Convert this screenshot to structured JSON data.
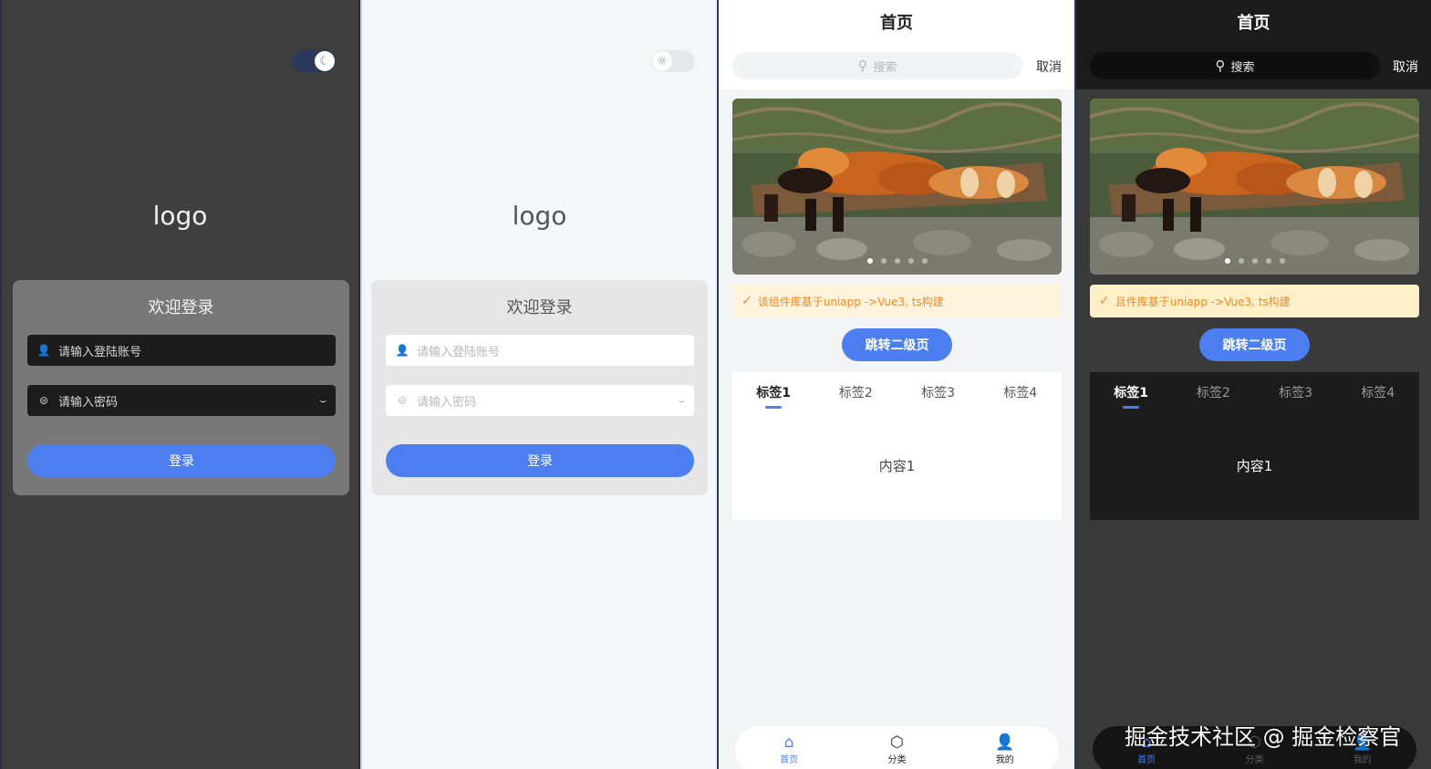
{
  "login": {
    "logo": "logo",
    "title": "欢迎登录",
    "account_placeholder": "请输入登陆账号",
    "password_placeholder": "请输入密码",
    "submit": "登录",
    "theme_dark_icon": "moon-icon",
    "theme_light_icon": "sun-icon"
  },
  "home": {
    "title": "首页",
    "search_placeholder": "搜索",
    "cancel": "取消",
    "banner_icon": "red-panda-photo",
    "banner_dots": 5,
    "banner_active_dot": 1,
    "notice_light": "该组件库基于uniapp ->Vue3, ts构建",
    "notice_dark": "且件库基于uniapp ->Vue3, ts构建",
    "jump_button": "跳转二级页",
    "tabs": [
      "标签1",
      "标签2",
      "标签3",
      "标签4"
    ],
    "active_tab": 0,
    "content": "内容1",
    "tabbar": [
      {
        "label": "首页",
        "icon": "home-icon"
      },
      {
        "label": "分类",
        "icon": "category-icon"
      },
      {
        "label": "我的",
        "icon": "user-icon"
      }
    ]
  },
  "watermark": "掘金技术社区 @ 掘金检察官",
  "colors": {
    "accent": "#4d7ef0",
    "notice_text": "#ee8a28"
  }
}
